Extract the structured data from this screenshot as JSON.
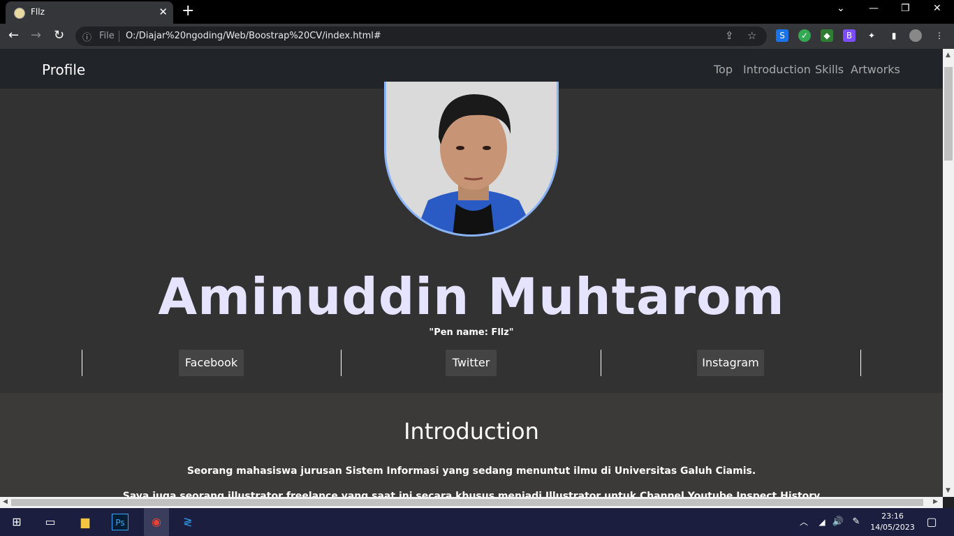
{
  "browser": {
    "tab_title": "Fllz",
    "tab_close": "✕",
    "new_tab": "+",
    "info_label": "File",
    "url": "O:/Diajar%20ngoding/Web/Boostrap%20CV/index.html#"
  },
  "navbar": {
    "brand": "Profile",
    "links": [
      "Top",
      "Introduction",
      "Skills",
      "Artworks"
    ]
  },
  "hero": {
    "name": "Aminuddin Muhtarom",
    "pen_name": "\"Pen name: Fllz\"",
    "socials": [
      "Facebook",
      "Twitter",
      "Instagram"
    ]
  },
  "intro": {
    "heading": "Introduction",
    "paragraph1": "Seorang mahasiswa jurusan Sistem Informasi yang sedang menuntut ilmu di Universitas Galuh Ciamis.",
    "paragraph2": "Saya juga seorang illustrator freelance yang saat ini secara khusus menjadi Illustrator untuk Channel Youtube Inspect History"
  },
  "taskbar": {
    "time": "23:16",
    "date": "14/05/2023"
  },
  "colors": {
    "accent_name": "#e6e3ff",
    "avatar_border": "#8ab4f8",
    "navbar_bg": "#212529"
  }
}
